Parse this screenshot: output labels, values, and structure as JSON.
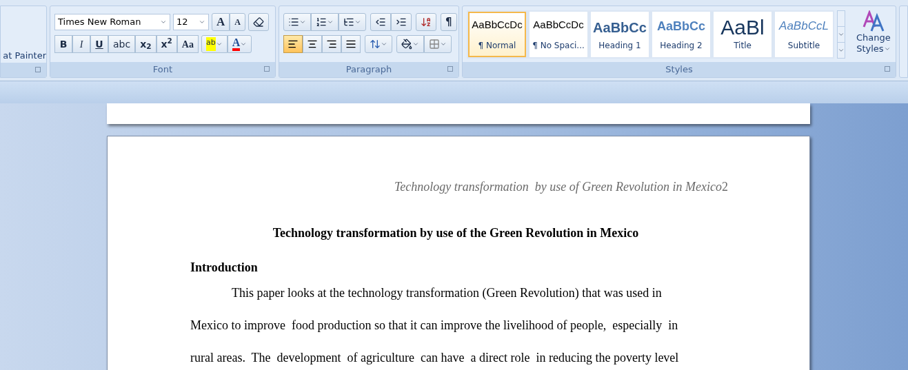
{
  "clipboard": {
    "format_painter": "at Painter"
  },
  "font": {
    "font_name": "Times New Roman",
    "font_size": "12",
    "grow": "A",
    "shrink": "A",
    "format_buttons": [
      {
        "kind": "bold",
        "label": "B"
      },
      {
        "kind": "italic",
        "label": "I"
      },
      {
        "kind": "underline",
        "label": "U"
      },
      {
        "kind": "strike",
        "label": "abc"
      },
      {
        "kind": "sub",
        "label": "x$_{2}$"
      },
      {
        "kind": "sup",
        "label": "x$^{2}$"
      },
      {
        "kind": "case",
        "label": "Aa"
      }
    ],
    "highlight": "ab",
    "font_color": "A",
    "label": "Font"
  },
  "paragraph": {
    "pilcrow": "¶",
    "alignment": [
      {
        "kind": "left",
        "selected": true
      },
      {
        "kind": "center",
        "selected": false
      },
      {
        "kind": "right",
        "selected": false
      },
      {
        "kind": "justify",
        "selected": false
      }
    ],
    "label": "Paragraph"
  },
  "styles": {
    "items": [
      {
        "kind": "normal",
        "preview": "AaBbCcDc",
        "name": "¶ Normal",
        "selected": true
      },
      {
        "kind": "normal",
        "preview": "AaBbCcDc",
        "name": "¶ No Spaci...",
        "selected": false
      },
      {
        "kind": "heading1",
        "preview": "AaBbCc",
        "name": "Heading 1",
        "selected": false
      },
      {
        "kind": "heading2",
        "preview": "AaBbCc",
        "name": "Heading 2",
        "selected": false
      },
      {
        "kind": "title",
        "preview": "AaBl",
        "name": "Title",
        "selected": false
      },
      {
        "kind": "subtitle",
        "preview": "AaBbCcL",
        "name": "Subtitle",
        "selected": false
      }
    ],
    "change_styles": [
      "Change",
      "Styles"
    ],
    "label": "Styles"
  },
  "document": {
    "header": "Technology transformation  by use of Green Revolution in Mexico",
    "page_number": "2",
    "title": "Technology transformation by use of the Green Revolution in Mexico",
    "heading": "Introduction",
    "paragraph_lines": [
      "This paper looks at the technology transformation (Green Revolution) that was used in",
      "Mexico to improve  food production so that it can improve the livelihood of people,  especially  in",
      "rural areas.  The  development  of agriculture  can have  a direct role  in reducing the poverty level"
    ]
  }
}
